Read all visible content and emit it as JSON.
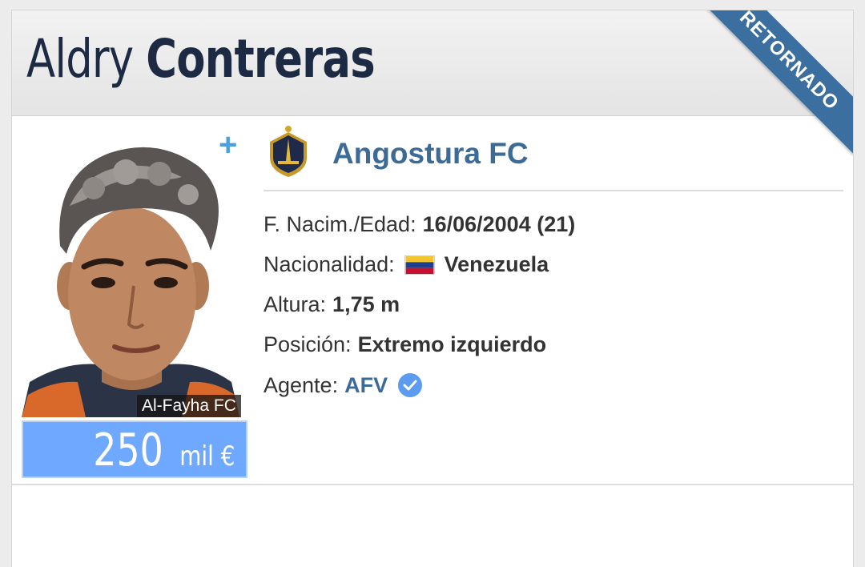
{
  "player": {
    "first_name": "Aldry",
    "last_name": "Contreras",
    "status_ribbon": "RETORNADO",
    "photo_club_caption": "Al-Fayha FC",
    "market_value": {
      "amount": "250",
      "unit": "mil €"
    }
  },
  "club": {
    "name": "Angostura FC"
  },
  "info": {
    "birth": {
      "label": "F. Nacim./Edad:",
      "value": "16/06/2004 (21)"
    },
    "nationality": {
      "label": "Nacionalidad:",
      "value": "Venezuela",
      "flag_icon": "venezuela-flag"
    },
    "height": {
      "label": "Altura:",
      "value": "1,75 m"
    },
    "position": {
      "label": "Posición:",
      "value": "Extremo izquierdo"
    },
    "agent": {
      "label": "Agente:",
      "value": "AFV",
      "verified_icon": "verified-check-icon"
    }
  },
  "colors": {
    "ribbon": "#3b6fa0",
    "link": "#3c6b97",
    "value_box": "#6ea8ff",
    "add_icon": "#4a9fdc"
  }
}
